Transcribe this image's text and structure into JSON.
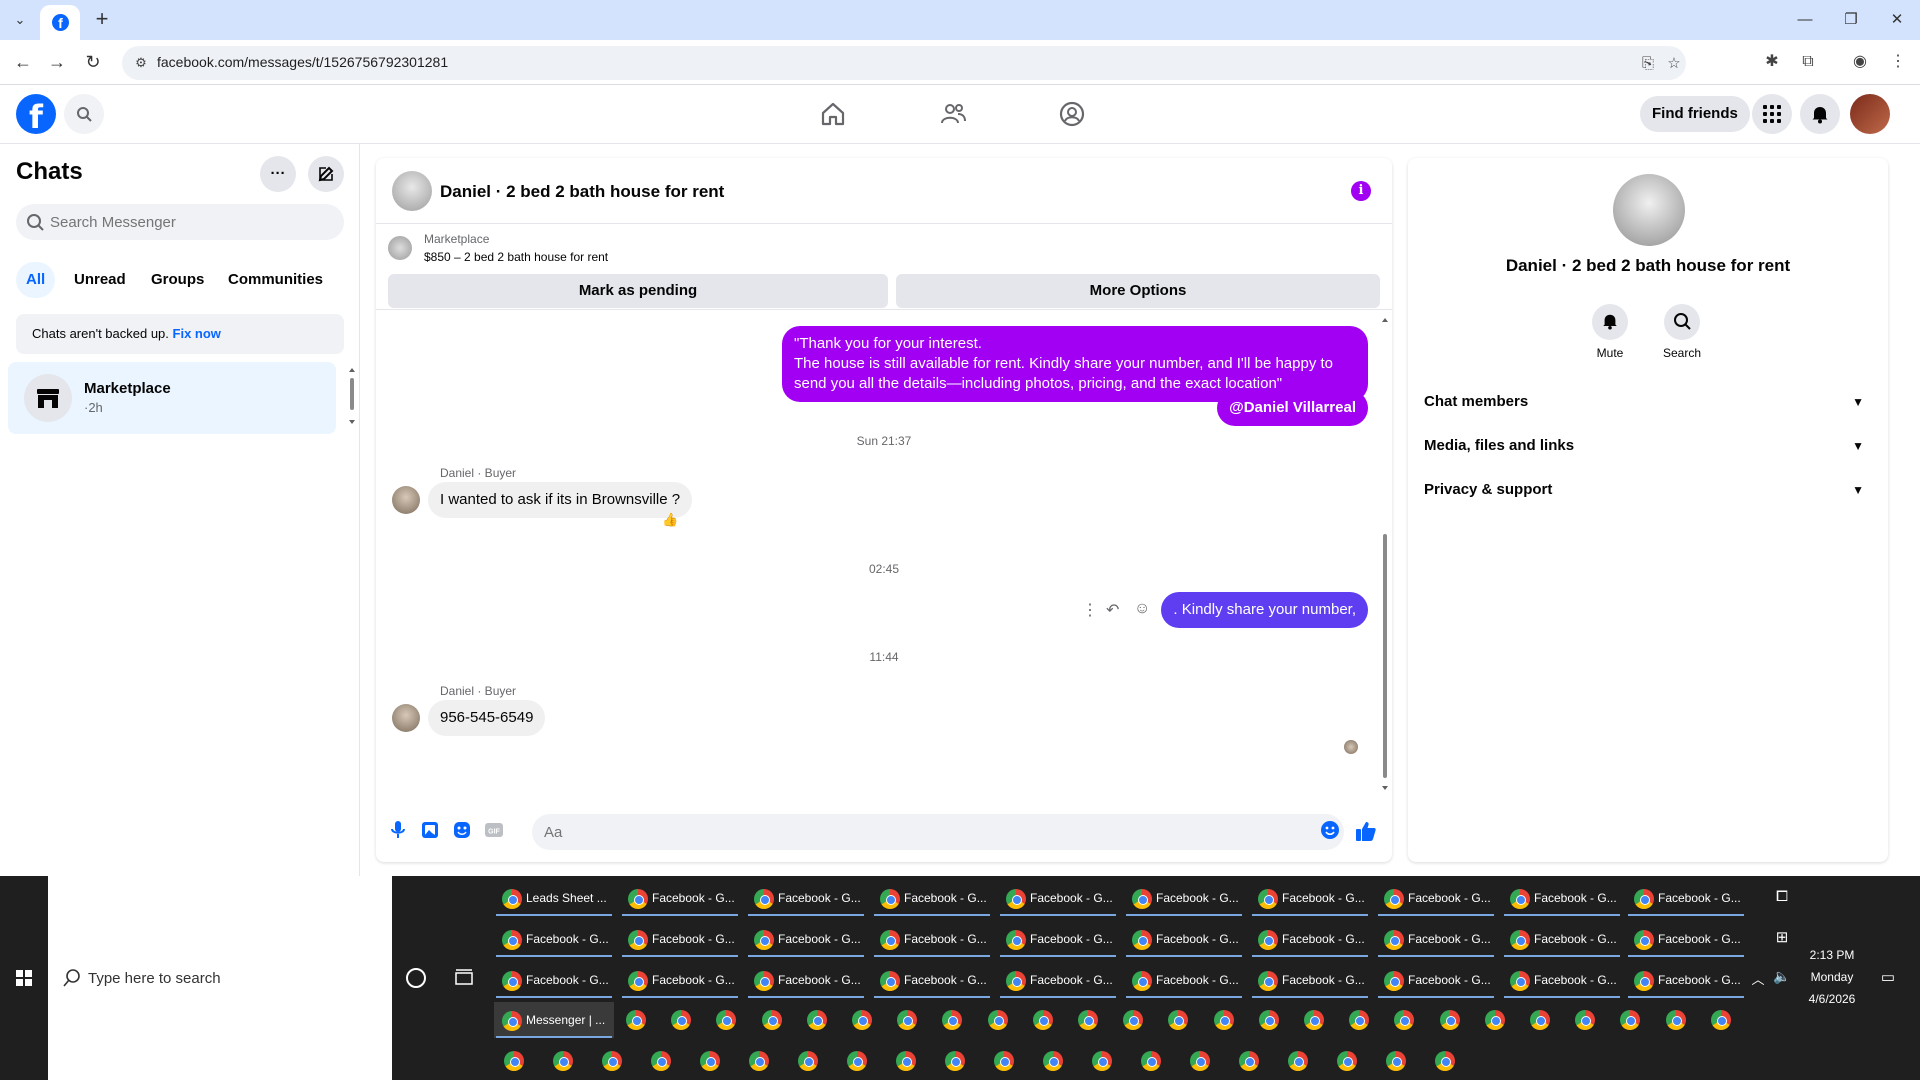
{
  "browser": {
    "url": "facebook.com/messages/t/1526756792301281"
  },
  "fb_header": {
    "find_friends_label": "Find friends"
  },
  "chats": {
    "title": "Chats",
    "search_placeholder": "Search Messenger",
    "filters": [
      "All",
      "Unread",
      "Groups",
      "Communities"
    ],
    "backup_text": "Chats aren't backed up.",
    "backup_link": "Fix now",
    "items": [
      {
        "name": "Marketplace",
        "time": "·2h"
      }
    ]
  },
  "conversation": {
    "title": "Daniel · 2 bed 2 bath house for rent",
    "marketplace_label": "Marketplace",
    "listing_title": "$850 – 2 bed 2 bath house for rent",
    "mark_pending_label": "Mark as pending",
    "more_options_label": "More Options",
    "messages": {
      "out1_line1": "\"Thank you for your interest.",
      "out1_line2": "The house is still available for rent. Kindly share your number, and I'll be happy to",
      "out1_line3": "send you all the details—including photos, pricing, and the exact location\"",
      "out1_mention": "@Daniel Villarreal",
      "ts1": "Sun 21:37",
      "in1_sender": "Daniel · Buyer",
      "in1_text": "I wanted to ask if its in Brownsville ?",
      "in1_reaction": "👍",
      "ts2": "02:45",
      "out2_text": ". Kindly share your number,",
      "ts3": "11:44",
      "in2_sender": "Daniel · Buyer",
      "in2_text": "956-545-6549"
    },
    "composer_placeholder": "Aa",
    "accent_color": "#a100f2"
  },
  "info_panel": {
    "name": "Daniel · 2 bed 2 bath house for rent",
    "actions": [
      "Mute",
      "Search"
    ],
    "sections": [
      "Chat members",
      "Media, files and links",
      "Privacy & support"
    ]
  },
  "taskbar": {
    "search_placeholder": "Type here to search",
    "row1": [
      "Leads Sheet ...",
      "Facebook - G...",
      "Facebook - G...",
      "Facebook - G...",
      "Facebook - G...",
      "Facebook - G...",
      "Facebook - G...",
      "Facebook - G...",
      "Facebook - G...",
      "Facebook - G..."
    ],
    "row2": [
      "Facebook - G...",
      "Facebook - G...",
      "Facebook - G...",
      "Facebook - G...",
      "Facebook - G...",
      "Facebook - G...",
      "Facebook - G...",
      "Facebook - G...",
      "Facebook - G...",
      "Facebook - G..."
    ],
    "row3": [
      "Facebook - G...",
      "Facebook - G...",
      "Facebook - G...",
      "Facebook - G...",
      "Facebook - G...",
      "Facebook - G...",
      "Facebook - G...",
      "Facebook - G...",
      "Facebook - G...",
      "Facebook - G..."
    ],
    "active_app": "Messenger | ...",
    "clock_time": "2:13 PM",
    "clock_day": "Monday",
    "clock_date": "4/6/2026"
  }
}
